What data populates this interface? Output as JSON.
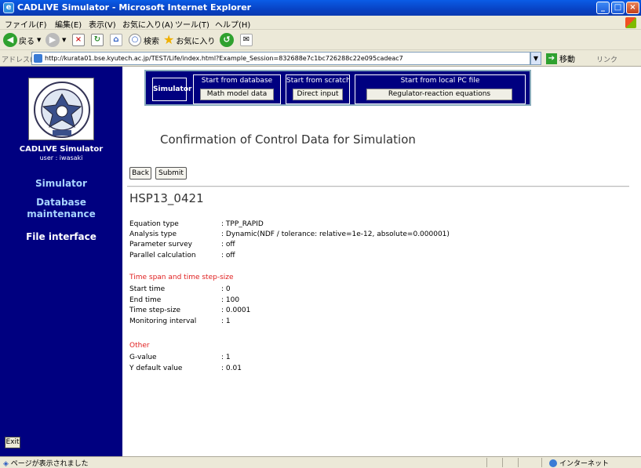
{
  "window": {
    "title": "CADLIVE Simulator - Microsoft Internet Explorer",
    "controls": [
      "_",
      "□",
      "×"
    ]
  },
  "menu": [
    "ファイル(F)",
    "編集(E)",
    "表示(V)",
    "お気に入り(A)",
    "ツール(T)",
    "ヘルプ(H)"
  ],
  "toolbar": {
    "back_label": "戻る",
    "search_label": "検索",
    "favorites_label": "お気に入り"
  },
  "address": {
    "label": "アドレス(D)",
    "url": "http://kurata01.bse.kyutech.ac.jp/TEST/Life/index.html?Example_Session=832688e7c1bc726288c22e095cadeac7",
    "go_label": "移動",
    "links_label": "リンク"
  },
  "sidebar": {
    "app_name": "CADLIVE Simulator",
    "user": "user : iwasaki",
    "nav": [
      "Simulator",
      "Database",
      "maintenance",
      "File interface"
    ],
    "exit_label": "Exit"
  },
  "topnav": {
    "simulator_label": "Simulator",
    "groups": [
      {
        "caption": "Start from database",
        "button": "Math model data"
      },
      {
        "caption": "Start from scratch",
        "button": "Direct input"
      },
      {
        "caption": "Start from local PC file",
        "button": "Regulator-reaction equations"
      }
    ]
  },
  "page": {
    "title": "Confirmation of Control Data for Simulation",
    "back_label": "Back",
    "submit_label": "Submit",
    "model_name": "HSP13_0421"
  },
  "settings": [
    {
      "label": "Equation type",
      "value": ": TPP_RAPID"
    },
    {
      "label": "Analysis type",
      "value": ": Dynamic(NDF / tolerance: relative=1e-12, absolute=0.000001)"
    },
    {
      "label": "Parameter survey",
      "value": ": off"
    },
    {
      "label": "Parallel calculation",
      "value": ": off"
    }
  ],
  "time_section": {
    "heading": "Time span and time step-size",
    "rows": [
      {
        "label": "Start time",
        "value": ": 0"
      },
      {
        "label": "End time",
        "value": ": 100"
      },
      {
        "label": "Time step-size",
        "value": ": 0.0001"
      },
      {
        "label": "Monitoring interval",
        "value": ": 1"
      }
    ]
  },
  "other_section": {
    "heading": "Other",
    "rows": [
      {
        "label": "G-value",
        "value": ": 1"
      },
      {
        "label": "Y default value",
        "value": ": 0.01"
      }
    ]
  },
  "status": {
    "text": "ページが表示されました",
    "zone": "インターネット"
  },
  "colors": {
    "sidebar": "#000080",
    "nav_link": "#a8d4ff",
    "section_heading": "#e02020"
  },
  "icons": [
    "ie-icon",
    "back-arrow-icon",
    "forward-arrow-icon",
    "stop-icon",
    "refresh-icon",
    "home-icon",
    "search-icon",
    "favorites-star-icon",
    "history-icon",
    "mail-icon",
    "page-icon",
    "go-arrow-icon",
    "globe-icon",
    "university-seal-icon"
  ]
}
